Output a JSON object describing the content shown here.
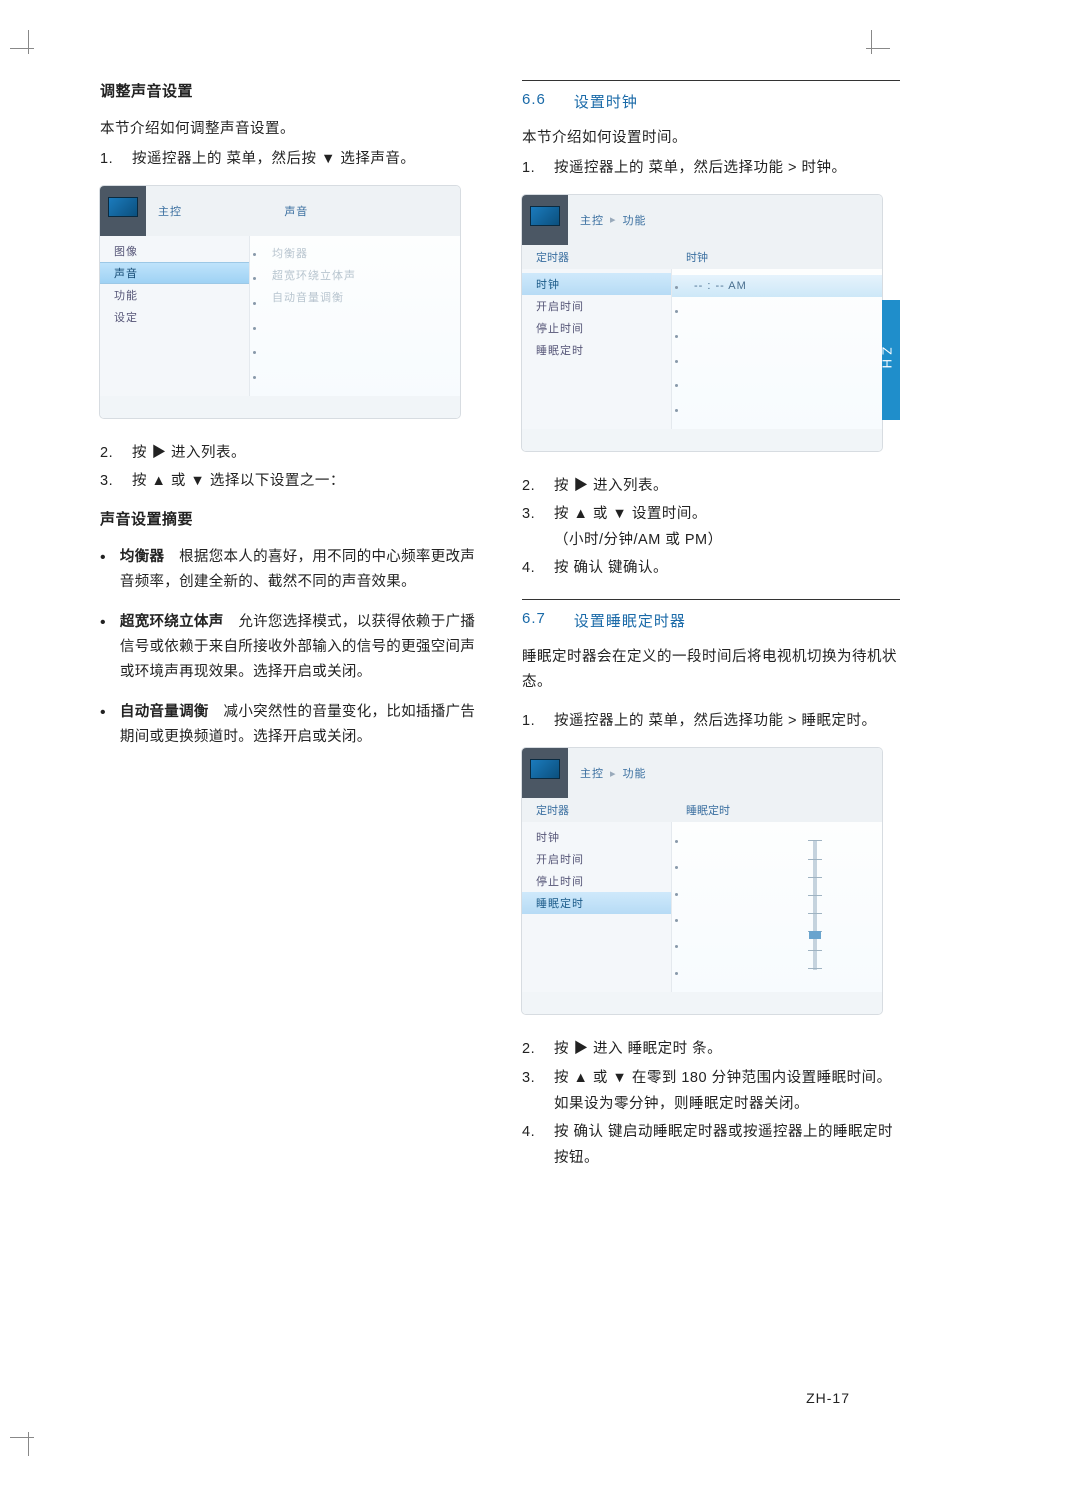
{
  "sidetab": "ZH",
  "footer": "ZH-17",
  "left": {
    "heading": "调整声音设置",
    "intro": "本节介绍如何调整声音设置。",
    "steps_a": [
      "按遥控器上的 菜单，然后按 ▼ 选择声音。"
    ],
    "osd1": {
      "crumb": "主控",
      "right_head": "声音",
      "left_items": [
        "图像",
        "声音",
        "功能",
        "设定"
      ],
      "left_selected_index": 1,
      "right_faded": [
        "均衡器",
        "超宽环绕立体声",
        "自动音量调衡"
      ]
    },
    "steps_b": [
      "按 ▶ 进入列表。",
      "按 ▲ 或 ▼ 选择以下设置之一："
    ],
    "sub_heading": "声音设置摘要",
    "bullets": [
      {
        "term": "均衡器",
        "desc": "　根据您本人的喜好，用不同的中心频率更改声音频率，创建全新的、截然不同的声音效果。"
      },
      {
        "term": "超宽环绕立体声",
        "desc": "　允许您选择模式，以获得依赖于广播信号或依赖于来自所接收外部输入的信号的更强空间声或环境声再现效果。选择开启或关闭。"
      },
      {
        "term": "自动音量调衡",
        "desc": "　减小突然性的音量变化，比如插播广告期间或更换频道时。选择开启或关闭。"
      }
    ]
  },
  "right": {
    "sec66_num": "6.6",
    "sec66_title": "设置时钟",
    "sec66_intro": "本节介绍如何设置时间。",
    "sec66_step1": "按遥控器上的 菜单，然后选择功能 > 时钟。",
    "osd2": {
      "crumb1": "主控",
      "crumb2": "功能",
      "left_head": "定时器",
      "right_head": "时钟",
      "left_items": [
        "时钟",
        "开启时间",
        "停止时间",
        "睡眠定时"
      ],
      "left_selected_index": 0,
      "value_row": "--  :  --     AM"
    },
    "sec66_steps_b": [
      "按 ▶ 进入列表。",
      "按 ▲ 或 ▼ 设置时间。",
      "（小时/分钟/AM 或 PM）",
      "按 确认 键确认。"
    ],
    "sec67_num": "6.7",
    "sec67_title": "设置睡眠定时器",
    "sec67_intro": "睡眠定时器会在定义的一段时间后将电视机切换为待机状态。",
    "sec67_step1": "按遥控器上的 菜单，然后选择功能 > 睡眠定时。",
    "osd3": {
      "crumb1": "主控",
      "crumb2": "功能",
      "left_head": "定时器",
      "right_head": "睡眠定时",
      "left_items": [
        "时钟",
        "开启时间",
        "停止时间",
        "睡眠定时"
      ],
      "left_selected_index": 3
    },
    "sec67_steps_b": [
      "按 ▶ 进入 睡眠定时 条。",
      "按 ▲ 或 ▼ 在零到 180 分钟范围内设置睡眠时间。如果设为零分钟，则睡眠定时器关闭。",
      "按 确认 键启动睡眠定时器或按遥控器上的睡眠定时按钮。"
    ]
  }
}
